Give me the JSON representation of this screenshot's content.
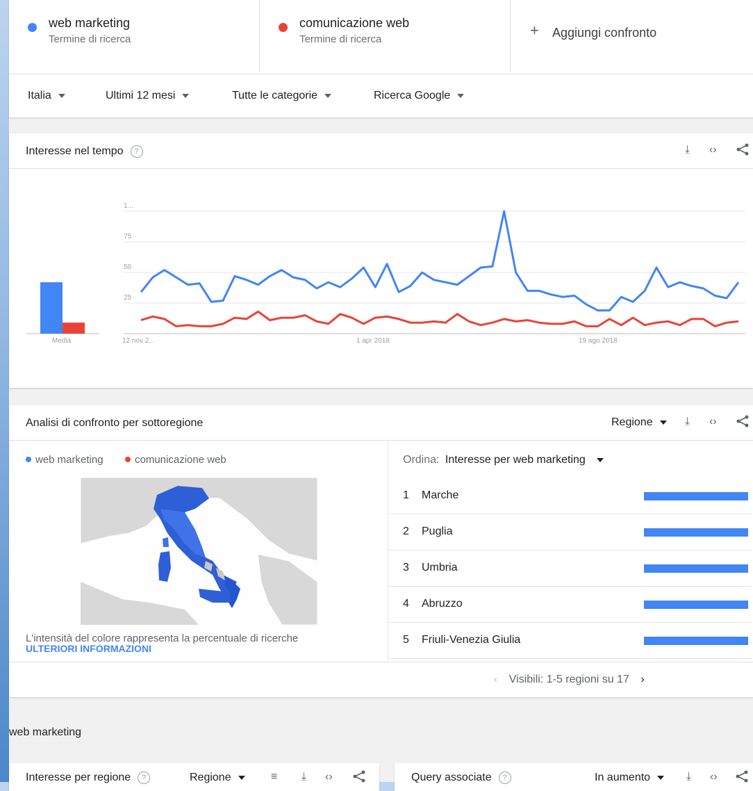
{
  "terms": [
    {
      "label": "web marketing",
      "sub": "Termine di ricerca",
      "color": "#4285f4"
    },
    {
      "label": "comunicazione web",
      "sub": "Termine di ricerca",
      "color": "#ea4335"
    }
  ],
  "add_compare": "Aggiungi confronto",
  "filters": [
    "Italia",
    "Ultimi 12 mesi",
    "Tutte le categorie",
    "Ricerca Google"
  ],
  "interest_time": {
    "title": "Interesse nel tempo",
    "avg_label": "Media"
  },
  "chart_data": {
    "type": "line",
    "ylim": [
      0,
      100
    ],
    "yticks": [
      "25",
      "50",
      "75",
      "1..."
    ],
    "xticks": [
      "12 nov 2...",
      "1 apr 2018",
      "19 ago 2018"
    ],
    "averages": [
      42,
      9
    ],
    "series": [
      {
        "name": "web marketing",
        "color": "#4285f4",
        "values": [
          34,
          46,
          52,
          46,
          40,
          41,
          26,
          27,
          47,
          44,
          40,
          47,
          52,
          46,
          44,
          37,
          42,
          38,
          45,
          54,
          38,
          57,
          34,
          39,
          50,
          44,
          42,
          40,
          47,
          54,
          55,
          100,
          50,
          35,
          35,
          32,
          30,
          31,
          24,
          19,
          19,
          30,
          26,
          35,
          54,
          38,
          42,
          39,
          37,
          31,
          29,
          42
        ]
      },
      {
        "name": "comunicazione web",
        "color": "#ea4335",
        "values": [
          11,
          14,
          12,
          6,
          7,
          6,
          6,
          8,
          13,
          12,
          18,
          11,
          13,
          13,
          15,
          10,
          8,
          16,
          13,
          8,
          13,
          14,
          12,
          9,
          9,
          10,
          9,
          16,
          10,
          7,
          9,
          12,
          10,
          11,
          9,
          8,
          8,
          10,
          6,
          6,
          12,
          7,
          13,
          7,
          9,
          10,
          7,
          12,
          12,
          6,
          9,
          10
        ]
      }
    ]
  },
  "subregion": {
    "title": "Analisi di confronto per sottoregione",
    "region_select": "Regione",
    "legend": [
      "web marketing",
      "comunicazione web"
    ],
    "sort_label": "Ordina:",
    "sort_value": "Interesse per web marketing",
    "rows": [
      {
        "rank": "1",
        "name": "Marche"
      },
      {
        "rank": "2",
        "name": "Puglia"
      },
      {
        "rank": "3",
        "name": "Umbria"
      },
      {
        "rank": "4",
        "name": "Abruzzo"
      },
      {
        "rank": "5",
        "name": "Friuli-Venezia Giulia"
      }
    ],
    "map_note": "L'intensità del colore rappresenta la percentuale di ricerche",
    "more_info": "ULTERIORI INFORMAZIONI",
    "pager": "Visibili: 1-5 regioni su 17"
  },
  "section_label": "web marketing",
  "bottom_left": {
    "title": "Interesse per regione",
    "select": "Regione"
  },
  "bottom_right": {
    "title": "Query associate",
    "select": "In aumento"
  }
}
